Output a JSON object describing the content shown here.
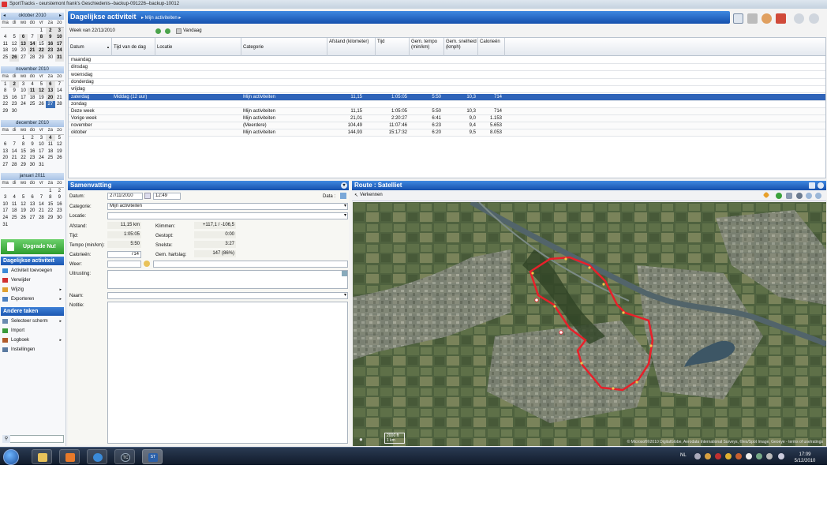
{
  "window": {
    "title": "SportTracks - ceurstemont frank's Geschiedenis--backup-091226--backup-10012"
  },
  "calendars": [
    {
      "month": "oktober 2010",
      "days": [
        "ma",
        "di",
        "wo",
        "do",
        "vr",
        "za",
        "zo"
      ],
      "weeks": [
        [
          "",
          "",
          "",
          "",
          "1",
          "2",
          "3"
        ],
        [
          "4",
          "5",
          "6",
          "7",
          "8",
          "9",
          "10"
        ],
        [
          "11",
          "12",
          "13",
          "14",
          "15",
          "16",
          "17"
        ],
        [
          "18",
          "19",
          "20",
          "21",
          "22",
          "23",
          "24"
        ],
        [
          "25",
          "26",
          "27",
          "28",
          "29",
          "30",
          "31"
        ]
      ],
      "bold": [
        "2",
        "3",
        "6",
        "8",
        "9",
        "10",
        "13",
        "14",
        "16",
        "17",
        "21",
        "22",
        "23",
        "24",
        "26",
        "31"
      ]
    },
    {
      "month": "november 2010",
      "days": [
        "ma",
        "di",
        "wo",
        "do",
        "vr",
        "za",
        "zo"
      ],
      "weeks": [
        [
          "1",
          "2",
          "3",
          "4",
          "5",
          "6",
          "7"
        ],
        [
          "8",
          "9",
          "10",
          "11",
          "12",
          "13",
          "14"
        ],
        [
          "15",
          "16",
          "17",
          "18",
          "19",
          "20",
          "21"
        ],
        [
          "22",
          "23",
          "24",
          "25",
          "26",
          "27",
          "28"
        ],
        [
          "29",
          "30",
          "",
          "",
          "",
          "",
          ""
        ]
      ],
      "bold": [
        "2",
        "6",
        "11",
        "12",
        "13",
        "20"
      ],
      "selected": "27"
    },
    {
      "month": "december 2010",
      "days": [
        "ma",
        "di",
        "wo",
        "do",
        "vr",
        "za",
        "zo"
      ],
      "weeks": [
        [
          "",
          "",
          "1",
          "2",
          "3",
          "4",
          "5"
        ],
        [
          "6",
          "7",
          "8",
          "9",
          "10",
          "11",
          "12"
        ],
        [
          "13",
          "14",
          "15",
          "16",
          "17",
          "18",
          "19"
        ],
        [
          "20",
          "21",
          "22",
          "23",
          "24",
          "25",
          "26"
        ],
        [
          "27",
          "28",
          "29",
          "30",
          "31",
          "",
          ""
        ]
      ],
      "bold": [
        "4"
      ]
    },
    {
      "month": "januari 2011",
      "days": [
        "ma",
        "di",
        "wo",
        "do",
        "vr",
        "za",
        "zo"
      ],
      "weeks": [
        [
          "",
          "",
          "",
          "",
          "",
          "1",
          "2"
        ],
        [
          "3",
          "4",
          "5",
          "6",
          "7",
          "8",
          "9"
        ],
        [
          "10",
          "11",
          "12",
          "13",
          "14",
          "15",
          "16"
        ],
        [
          "17",
          "18",
          "19",
          "20",
          "21",
          "22",
          "23"
        ],
        [
          "24",
          "25",
          "26",
          "27",
          "28",
          "29",
          "30"
        ],
        [
          "31",
          "",
          "",
          "",
          "",
          "",
          ""
        ]
      ],
      "bold": []
    }
  ],
  "upgrade": {
    "label": "Upgrade Nu!"
  },
  "daily_panel": {
    "title": "Dagelijkse activiteit",
    "items": [
      {
        "label": "Activiteit toevoegen",
        "icon": "add-activity-icon"
      },
      {
        "label": "Verwijder",
        "icon": "delete-icon"
      },
      {
        "label": "Wijzig",
        "icon": "edit-icon",
        "arrow": "▸"
      },
      {
        "label": "Exporteren",
        "icon": "export-icon",
        "arrow": "▸"
      }
    ]
  },
  "other_panel": {
    "title": "Andere taken",
    "items": [
      {
        "label": "Selecteer scherm",
        "icon": "screen-icon",
        "arrow": "▸"
      },
      {
        "label": "Import",
        "icon": "import-icon"
      },
      {
        "label": "Logboek",
        "icon": "logbook-icon",
        "arrow": "▸"
      },
      {
        "label": "Instellingen",
        "icon": "settings-icon"
      }
    ]
  },
  "header": {
    "title": "Dagelijkse activiteit",
    "breadcrumb": "▸ Mijn activiteiten ▸"
  },
  "weekbar": {
    "label": "Week van 22/11/2010",
    "today": "Vandaag"
  },
  "table": {
    "columns": [
      "Datum",
      "Tijd van de dag",
      "Locatie",
      "Categorie",
      "Afstand (kilometer)",
      "Tijd",
      "Gem. tempo (min/km)",
      "Gem. snelheid (kmph)",
      "Calorieën"
    ],
    "sort_indicator": "▲",
    "day_rows": [
      {
        "datum": "maandag"
      },
      {
        "datum": "dinsdag"
      },
      {
        "datum": "woensdag"
      },
      {
        "datum": "donderdag"
      },
      {
        "datum": "vrijdag"
      },
      {
        "datum": "zaterdag",
        "tijd_dag": "Middag (12 uur)",
        "categorie": "Mijn activiteiten",
        "afstand": "11,15",
        "tijd": "1:05:05",
        "tempo": "5:50",
        "snelheid": "10,3",
        "calorieen": "714",
        "selected": true
      },
      {
        "datum": "zondag"
      }
    ],
    "summary_rows": [
      {
        "datum": "Deze week",
        "categorie": "Mijn activiteiten",
        "afstand": "11,15",
        "tijd": "1:05:05",
        "tempo": "5:50",
        "snelheid": "10,3",
        "calorieen": "714"
      },
      {
        "datum": "Vorige week",
        "categorie": "Mijn activiteiten",
        "afstand": "21,01",
        "tijd": "2:20:27",
        "tempo": "6:41",
        "snelheid": "9,0",
        "calorieen": "1.153"
      },
      {
        "datum": "november",
        "categorie": "(Meerdere)",
        "afstand": "104,49",
        "tijd": "11:07:46",
        "tempo": "6:23",
        "snelheid": "9,4",
        "calorieen": "5.653"
      },
      {
        "datum": "oktober",
        "categorie": "Mijn activiteiten",
        "afstand": "144,93",
        "tijd": "15:17:32",
        "tempo": "6:20",
        "snelheid": "9,5",
        "calorieen": "8.053"
      }
    ]
  },
  "summary": {
    "title": "Samenvatting",
    "datum_label": "Datum:",
    "datum": "27/11/2010",
    "tijd": "12:49",
    "data_label": "Data :",
    "categorie_label": "Categorie:",
    "categorie": "Mijn activiteiten",
    "locatie_label": "Locatie:",
    "afstand_label": "Afstand:",
    "afstand": "11,15 km",
    "tijd_label": "Tijd:",
    "tijd_val": "1:05:05",
    "tempo_label": "Tempo (min/km):",
    "tempo": "5:50",
    "calorieen_label": "Calorieën:",
    "calorieen": "714",
    "klimmen_label": "Klimmen:",
    "klimmen": "+117,1 / -106,5",
    "gestopt_label": "Gestopt:",
    "gestopt": "0:00",
    "snelste_label": "Snelste:",
    "snelste": "3:27",
    "hartslag_label": "Gem. hartslag:",
    "hartslag": "147 (86%)",
    "weer_label": "Weer:",
    "uitrusting_label": "Uitrusting:",
    "naam_label": "Naam:",
    "notitie_label": "Notitie:"
  },
  "route": {
    "title": "Route : Satelliet",
    "mode": "Verkennen",
    "scale_ft": "2000 ft",
    "scale_km": "1 km",
    "attribution": "© Microsoft©2010 DigitalGlobe, Aerodata International Surveys, ©les/Spot Image, Geoeye - terms of use/ratings",
    "route_color": "#e8202a"
  },
  "taskbar": {
    "tc": "TC",
    "st": "ST",
    "lang": "NL",
    "time": "17:09",
    "date": "5/12/2010"
  }
}
